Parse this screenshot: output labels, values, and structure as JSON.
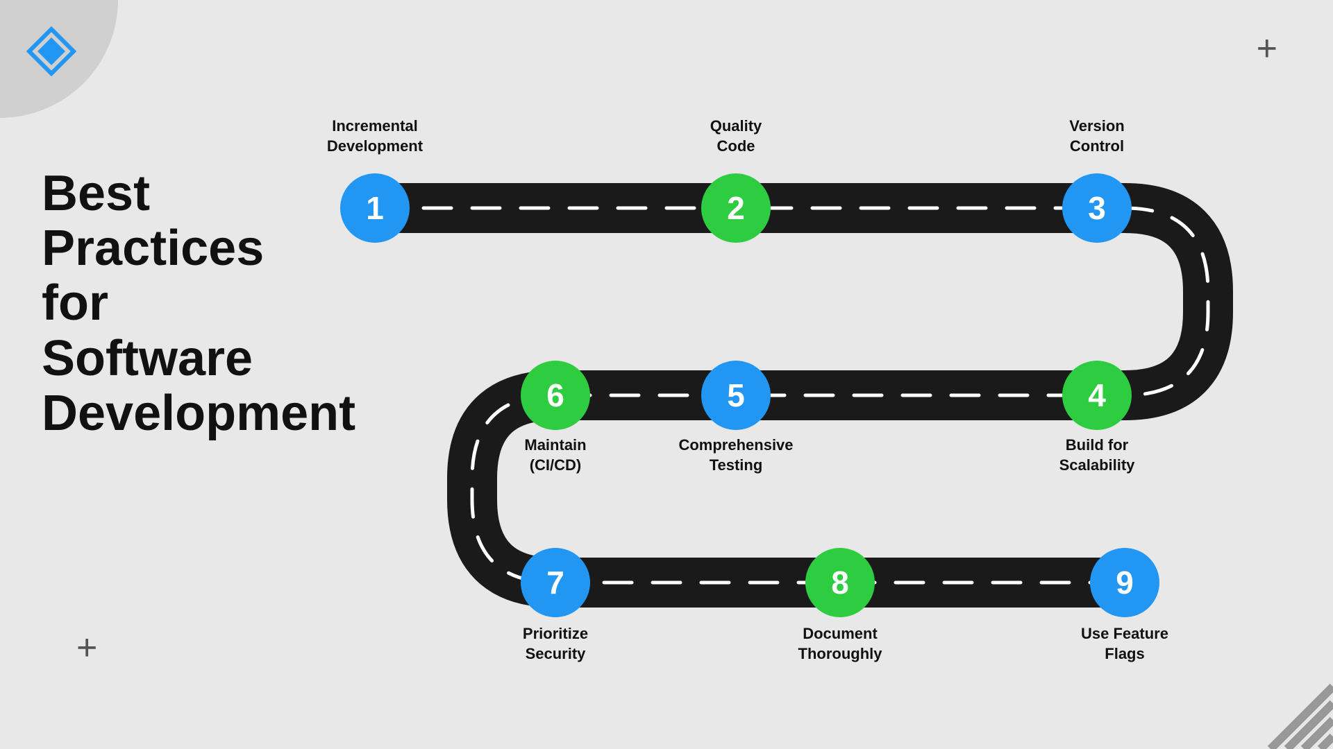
{
  "logo": {
    "alt": "Diamond logo"
  },
  "decorators": {
    "plus_top_right": "+",
    "plus_bottom_left": "+"
  },
  "title": {
    "line1": "Best",
    "line2": "Practices",
    "line3": "for",
    "line4": "Software",
    "line5": "Development"
  },
  "steps": [
    {
      "id": 1,
      "number": "1",
      "color": "blue",
      "label": "Incremental\nDevelopment",
      "label_position": "above"
    },
    {
      "id": 2,
      "number": "2",
      "color": "green",
      "label": "Quality\nCode",
      "label_position": "above"
    },
    {
      "id": 3,
      "number": "3",
      "color": "blue",
      "label": "Version\nControl",
      "label_position": "above"
    },
    {
      "id": 4,
      "number": "4",
      "color": "green",
      "label": "Build for\nScalability",
      "label_position": "below"
    },
    {
      "id": 5,
      "number": "5",
      "color": "blue",
      "label": "Comprehensive\nTesting",
      "label_position": "below"
    },
    {
      "id": 6,
      "number": "6",
      "color": "green",
      "label": "Maintain\n(CI/CD)",
      "label_position": "below"
    },
    {
      "id": 7,
      "number": "7",
      "color": "blue",
      "label": "Prioritize\nSecurity",
      "label_position": "below"
    },
    {
      "id": 8,
      "number": "8",
      "color": "green",
      "label": "Document\nThoroughly",
      "label_position": "below"
    },
    {
      "id": 9,
      "number": "9",
      "color": "blue",
      "label": "Use Feature\nFlags",
      "label_position": "below"
    }
  ],
  "colors": {
    "blue": "#2196F3",
    "green": "#27ae60",
    "road": "#1a1a1a",
    "background": "#e8e8e8"
  }
}
